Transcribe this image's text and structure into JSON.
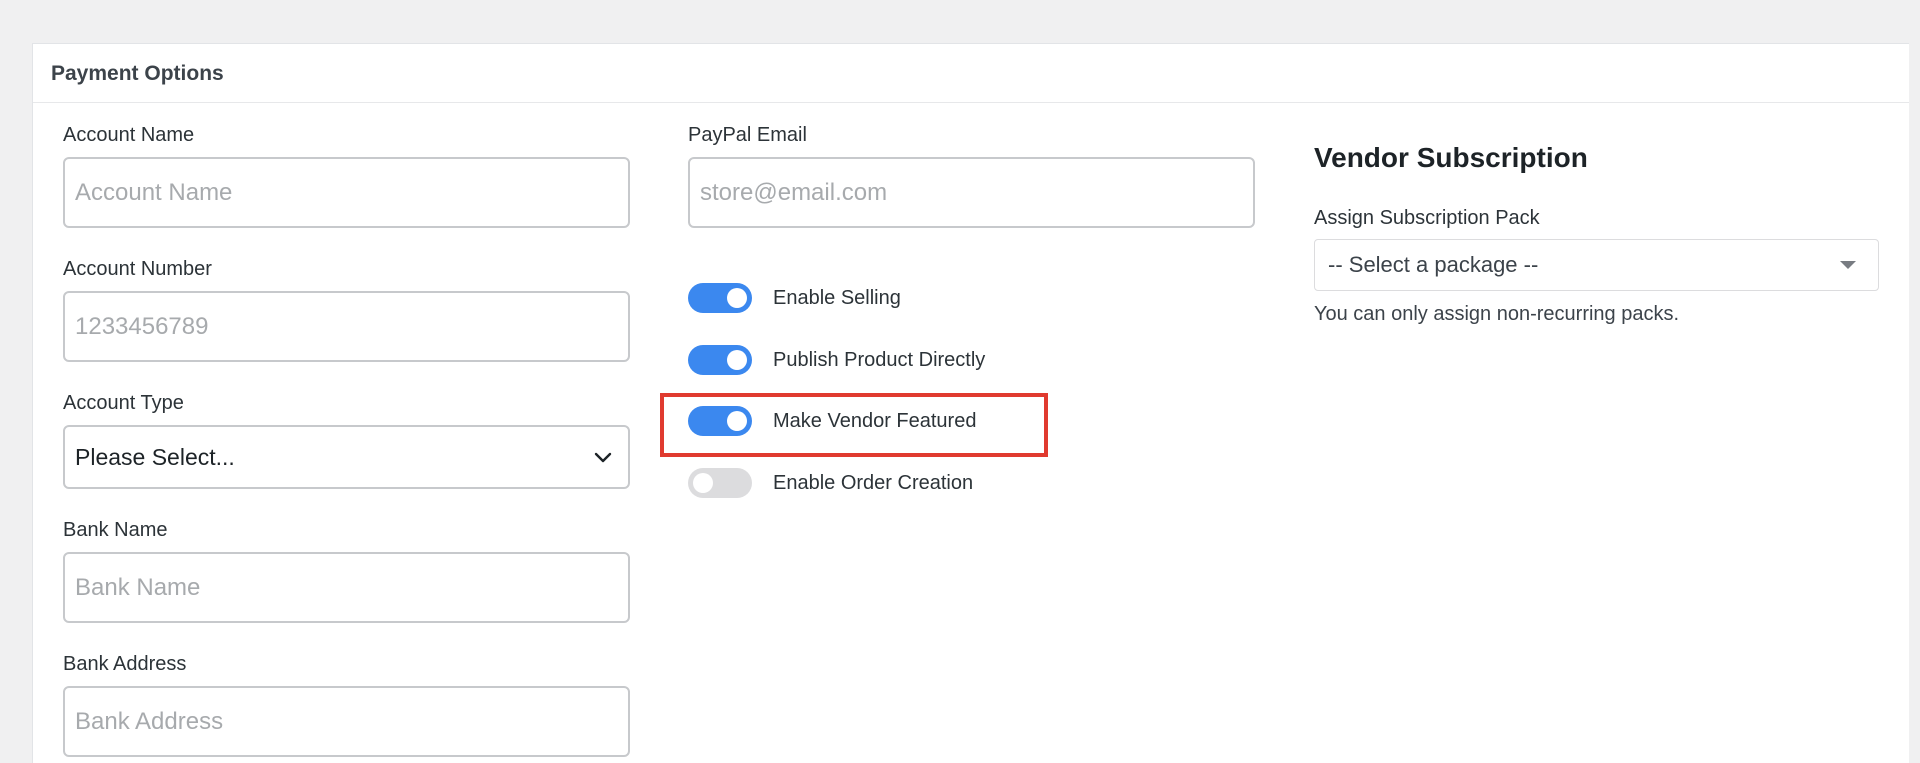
{
  "panel": {
    "title": "Payment Options"
  },
  "bank": {
    "account_name": {
      "label": "Account Name",
      "placeholder": "Account Name",
      "value": ""
    },
    "account_number": {
      "label": "Account Number",
      "placeholder": "1233456789",
      "value": ""
    },
    "account_type": {
      "label": "Account Type",
      "selected": "Please Select..."
    },
    "bank_name": {
      "label": "Bank Name",
      "placeholder": "Bank Name",
      "value": ""
    },
    "bank_address": {
      "label": "Bank Address",
      "placeholder": "Bank Address",
      "value": ""
    }
  },
  "paypal": {
    "label": "PayPal Email",
    "placeholder": "store@email.com",
    "value": ""
  },
  "toggles": [
    {
      "label": "Enable Selling",
      "on": true
    },
    {
      "label": "Publish Product Directly",
      "on": true
    },
    {
      "label": "Make Vendor Featured",
      "on": true,
      "highlighted": true
    },
    {
      "label": "Enable Order Creation",
      "on": false
    }
  ],
  "subscription": {
    "heading": "Vendor Subscription",
    "pack_label": "Assign Subscription Pack",
    "pack_selected": "-- Select a package --",
    "help": "You can only assign non-recurring packs."
  },
  "colors": {
    "toggle_on": "#3b88ef",
    "toggle_off": "#dcdcde",
    "highlight": "#e03a2f",
    "page_bg": "#f0f0f1"
  },
  "icons": {
    "account_type_chevron": "chevron-down-icon",
    "pack_caret": "caret-down-icon"
  }
}
